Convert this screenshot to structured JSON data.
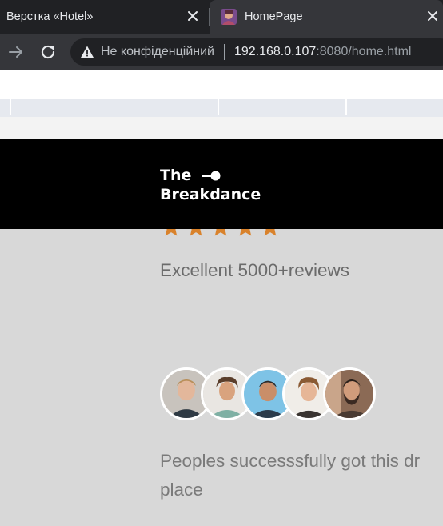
{
  "browser": {
    "tabs": [
      {
        "title": "Верстка «Hotel»",
        "active": false
      },
      {
        "title": "HomePage",
        "active": true
      }
    ],
    "address_bar": {
      "security_label": "Не конфіденційний",
      "url_host": "192.168.0.107",
      "url_rest": ":8080/home.html"
    }
  },
  "header": {
    "logo_line1": "The",
    "logo_line2": "Breakdance",
    "background": "#000000"
  },
  "rating": {
    "stars": 5,
    "star_color": "#d9822b",
    "reviews_text": "Excellent 5000+reviews"
  },
  "avatars": [
    {
      "name": "avatar-1-icon"
    },
    {
      "name": "avatar-2-icon"
    },
    {
      "name": "avatar-3-icon"
    },
    {
      "name": "avatar-4-icon"
    },
    {
      "name": "avatar-5-icon"
    }
  ],
  "peoples": {
    "line1": "Peoples successsfully got this dr",
    "line2": "place"
  }
}
